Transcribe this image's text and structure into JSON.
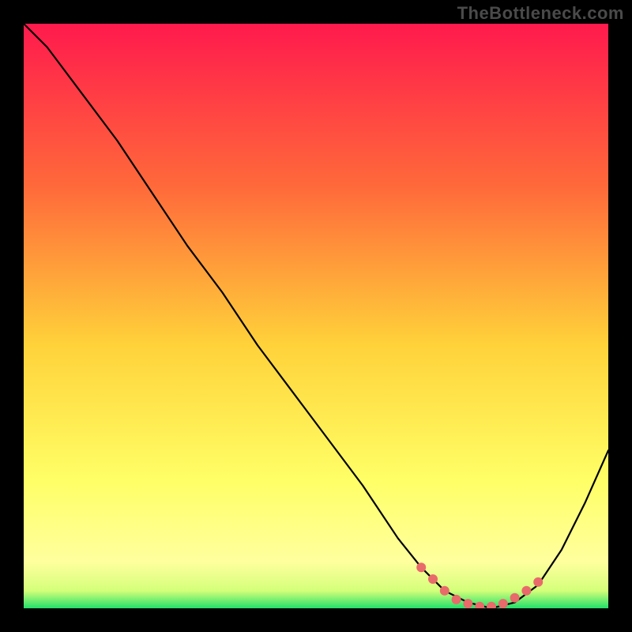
{
  "watermark": "TheBottleneck.com",
  "colors": {
    "frame": "#000000",
    "gradient_top": "#ff1a4d",
    "gradient_mid1": "#ff6a3a",
    "gradient_mid2": "#ffd23a",
    "gradient_mid3": "#ffff66",
    "gradient_bottom_yellow": "#ffff9e",
    "gradient_bottom_green": "#22e06a",
    "curve": "#000000",
    "marker": "#e96a6a"
  },
  "chart_data": {
    "type": "line",
    "title": "",
    "xlabel": "",
    "ylabel": "",
    "xlim": [
      0,
      100
    ],
    "ylim": [
      0,
      100
    ],
    "grid": false,
    "legend": null,
    "series": [
      {
        "name": "bottleneck-curve",
        "x": [
          0,
          4,
          10,
          16,
          22,
          28,
          34,
          40,
          46,
          52,
          58,
          64,
          68,
          72,
          76,
          80,
          84,
          88,
          92,
          96,
          100
        ],
        "y": [
          100,
          96,
          88,
          80,
          71,
          62,
          54,
          45,
          37,
          29,
          21,
          12,
          7,
          3,
          1,
          0,
          1,
          4,
          10,
          18,
          27
        ]
      }
    ],
    "optimal_zone": {
      "name": "optimal-markers",
      "x": [
        68,
        70,
        72,
        74,
        76,
        78,
        80,
        82,
        84,
        86,
        88
      ],
      "y": [
        7,
        5,
        3,
        1.5,
        0.8,
        0.3,
        0.3,
        0.8,
        1.8,
        3,
        4.5
      ]
    }
  }
}
